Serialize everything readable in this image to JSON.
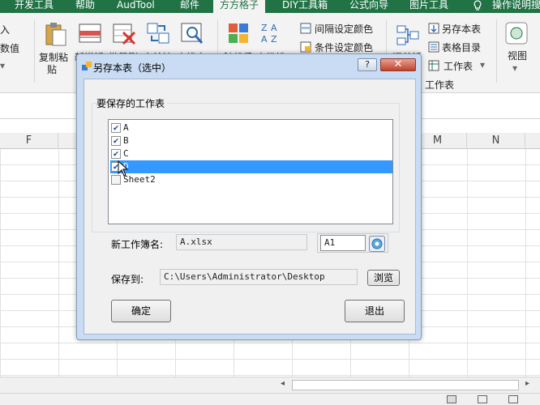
{
  "ribbon": {
    "tabs": [
      {
        "label": "开发工具"
      },
      {
        "label": "帮助"
      },
      {
        "label": "AudTool"
      },
      {
        "label": "邮件"
      },
      {
        "label": "方方格子",
        "active": true
      },
      {
        "label": "DIY工具箱"
      },
      {
        "label": "公式向导"
      },
      {
        "label": "图片工具"
      },
      {
        "label": "操作说明搜"
      }
    ],
    "left_group": {
      "line1": "入",
      "line2": "数值"
    },
    "buttons": {
      "copy_paste_1": "复制粘",
      "copy_paste_2": "贴",
      "new_insert": "新增插",
      "batch_delete": "批量删",
      "merge_convert": "合并转",
      "find_locate": "查找定",
      "random_repeat": "随机重",
      "advanced_sort": "高级排",
      "interval_color": "间隔设定颜色",
      "cond_color": "条件设定颜色",
      "summary_split": "汇总拆",
      "save_sheet": "另存本表",
      "sheet_toc": "表格目录",
      "worksheet": "工作表",
      "worksheet_group": "工作表",
      "view": "视图"
    }
  },
  "sheet": {
    "columns": [
      {
        "letter": "F"
      },
      {
        "letter": "M"
      },
      {
        "letter": "N"
      }
    ]
  },
  "dialog": {
    "title": "另存本表（选中）",
    "help": "?",
    "close": "✕",
    "group_label": "要保存的工作表",
    "sheets": [
      {
        "name": "A",
        "checked": true,
        "selected": false
      },
      {
        "name": "B",
        "checked": true,
        "selected": false
      },
      {
        "name": "C",
        "checked": true,
        "selected": false
      },
      {
        "name": "D",
        "checked": true,
        "selected": true
      },
      {
        "name": "Sheet2",
        "checked": false,
        "selected": false
      }
    ],
    "new_workbook_label": "新工作簿名:",
    "new_workbook_value": "A.xlsx",
    "cell_ref": "A1",
    "save_to_label": "保存到:",
    "save_to_value": "C:\\Users\\Administrator\\Desktop",
    "browse": "浏览",
    "ok": "确定",
    "exit": "退出"
  },
  "colors": {
    "accent": "#217346",
    "selection": "#3399ff",
    "dialog_frame": "#c9dcf3"
  }
}
